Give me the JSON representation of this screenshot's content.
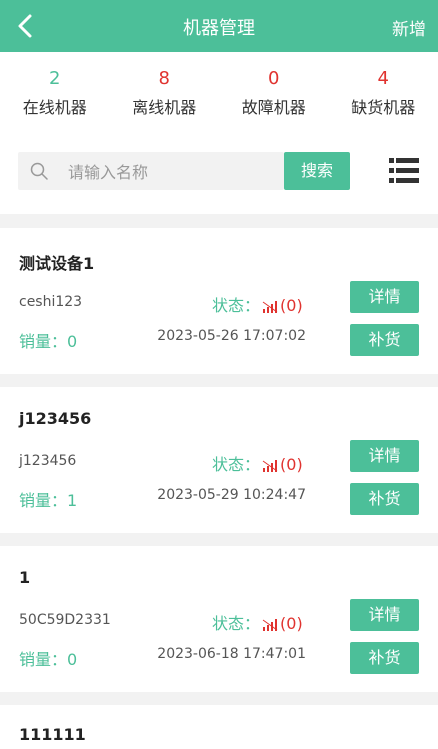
{
  "header": {
    "title": "机器管理",
    "add_label": "新增"
  },
  "stats": [
    {
      "value": "2",
      "label": "在线机器",
      "color": "#4cbf99"
    },
    {
      "value": "8",
      "label": "离线机器",
      "color": "#e0332f"
    },
    {
      "value": "0",
      "label": "故障机器",
      "color": "#e0332f"
    },
    {
      "value": "4",
      "label": "缺货机器",
      "color": "#e0332f"
    }
  ],
  "search": {
    "placeholder": "请输入名称",
    "button_label": "搜索"
  },
  "labels": {
    "status": "状态：",
    "detail": "详情",
    "restock": "补货"
  },
  "machines": [
    {
      "name": "测试设备1",
      "code": "ceshi123",
      "status_count": "(0)",
      "sales": "销量：0",
      "time": "2023-05-26 17:07:02"
    },
    {
      "name": "j123456",
      "code": "j123456",
      "status_count": "(0)",
      "sales": "销量：1",
      "time": "2023-05-29 10:24:47"
    },
    {
      "name": "1",
      "code": "50C59D2331",
      "status_count": "(0)",
      "sales": "销量：0",
      "time": "2023-06-18 17:47:01"
    },
    {
      "name": "111111"
    }
  ]
}
